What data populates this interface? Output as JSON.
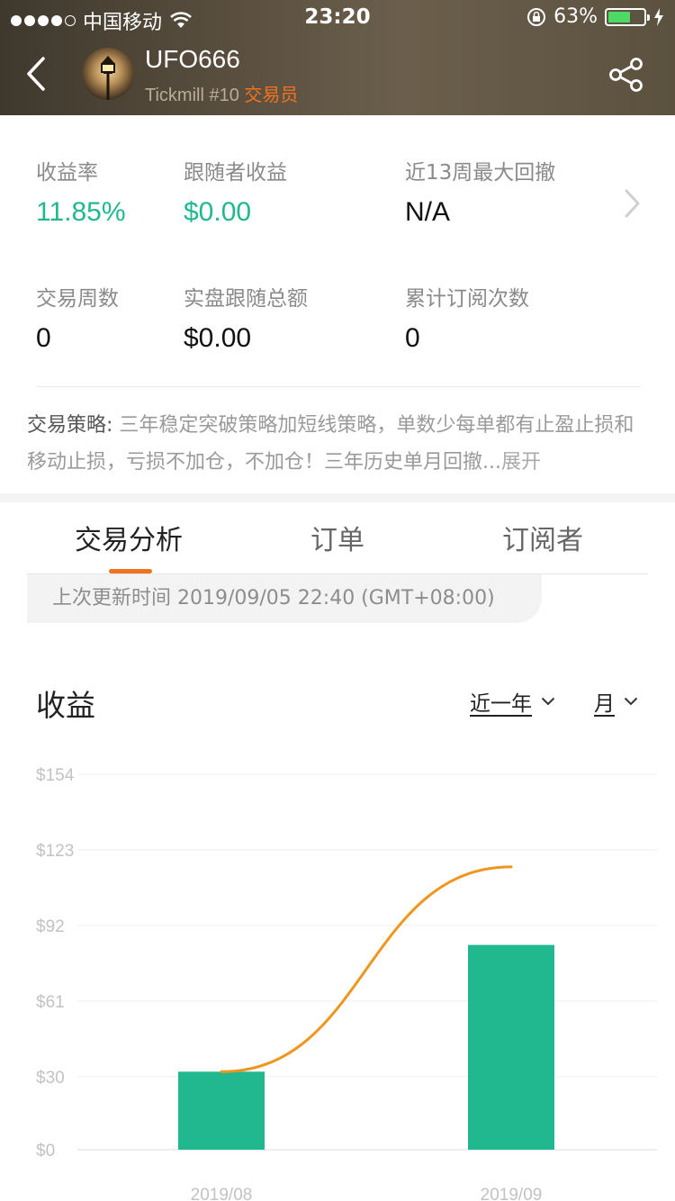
{
  "status_bar": {
    "carrier": "中国移动",
    "time": "23:20",
    "battery": "63%",
    "battery_level": 0.63
  },
  "header": {
    "trader_name": "UFO666",
    "broker_rank": "Tickmill #10",
    "role": "交易员"
  },
  "stats": [
    {
      "label": "收益率",
      "value": "11.85%"
    },
    {
      "label": "跟随者收益",
      "value": "$0.00"
    },
    {
      "label": "近13周最大回撤",
      "value": "N/A"
    },
    {
      "label": "交易周数",
      "value": "0"
    },
    {
      "label": "实盘跟随总额",
      "value": "$0.00"
    },
    {
      "label": "累计订阅次数",
      "value": "0"
    }
  ],
  "strategy": {
    "label": "交易策略:",
    "text": " 三年稳定突破策略加短线策略，单数少每单都有止盈止损和移动止损，亏损不加仓，不加仓！三年历史单月回撤...",
    "expand": "展开"
  },
  "tabs": [
    "交易分析",
    "订单",
    "订阅者"
  ],
  "update_time": "上次更新时间 2019/09/05 22:40 (GMT+08:00)",
  "profit": {
    "title": "收益",
    "period_filter": "近一年",
    "interval_filter": "月"
  },
  "chart_data": {
    "type": "bar",
    "categories": [
      "2019/08",
      "2019/09"
    ],
    "series": [
      {
        "type": "bar",
        "values": [
          32,
          84
        ],
        "color": "#21b890"
      },
      {
        "type": "line",
        "values": [
          32,
          116
        ],
        "color": "#f0961e"
      }
    ],
    "y_ticks": [
      "$0",
      "$30",
      "$61",
      "$92",
      "$123",
      "$154"
    ],
    "ylim": [
      0,
      154
    ],
    "grid": true
  }
}
